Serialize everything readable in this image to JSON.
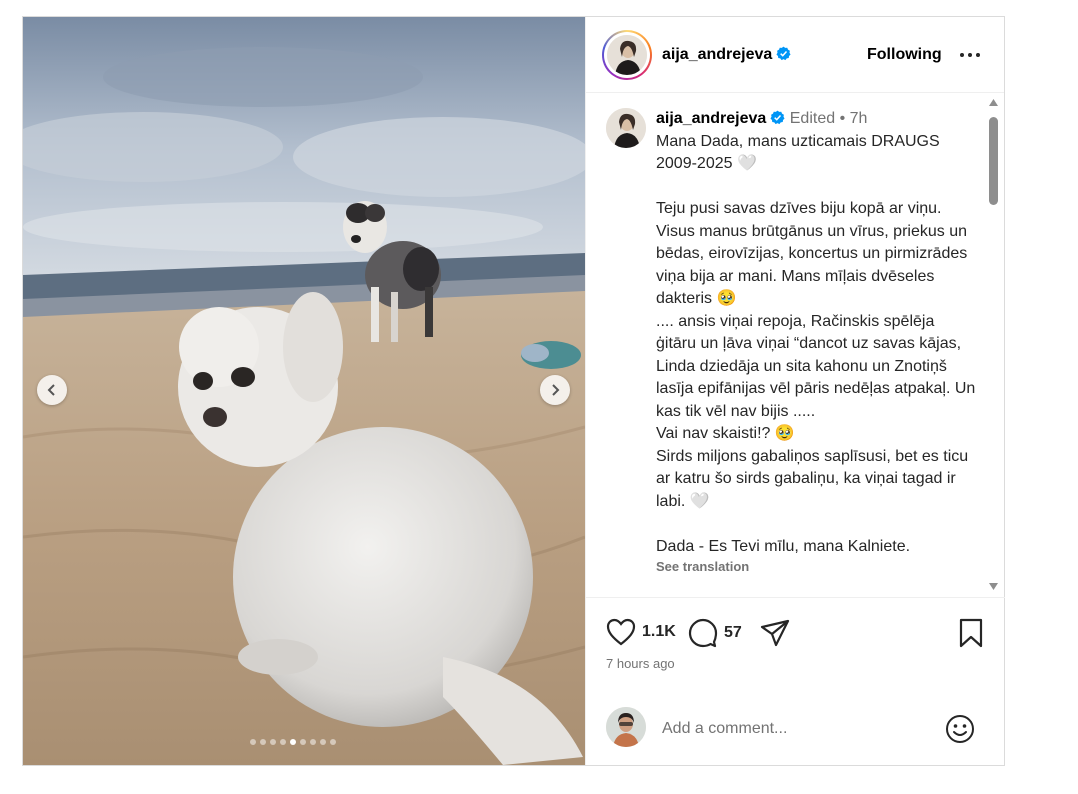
{
  "post": {
    "username": "aija_andrejeva",
    "follow_label": "Following",
    "more_icon": "more-horizontal-icon",
    "media_count": 9,
    "active_media_index": 4
  },
  "caption": {
    "username": "aija_andrejeva",
    "edited_label": "Edited",
    "separator": "•",
    "age": "7h",
    "text": "Mana Dada, mans uzticamais DRAUGS 2009-2025 🤍\n\nTeju pusi savas dzīves biju kopā ar viņu. Visus manus brūtgānus un vīrus, priekus un bēdas, eirovīzijas, koncertus un pirmizrādes  viņa bija ar mani. Mans mīļais dvēseles dakteris 🥹\n.... ansis viņai repoja, Račinskis spēlēja ģitāru un ļāva viņai “dancot uz savas kājas, Linda dziedāja un sita kahonu un Znotiņš lasīja epifānijas vēl pāris nedēļas atpakaļ. Un kas tik vēl nav bijis .....\nVai nav skaisti!? 🥹\nSirds miljons gabaliņos saplīsusi, bet es ticu ar katru šo sirds gabaliņu, ka viņai tagad ir labi. 🤍\n\nDada - Es Tevi mīlu, mana Kalniete.",
    "see_translation": "See translation"
  },
  "actions": {
    "likes": "1.1K",
    "comments": "57",
    "posted_ago": "7 hours ago"
  },
  "comment_box": {
    "placeholder": "Add a comment..."
  },
  "colors": {
    "verified": "#0095f6",
    "secondary_text": "#737373",
    "border": "#dbdbdb"
  }
}
